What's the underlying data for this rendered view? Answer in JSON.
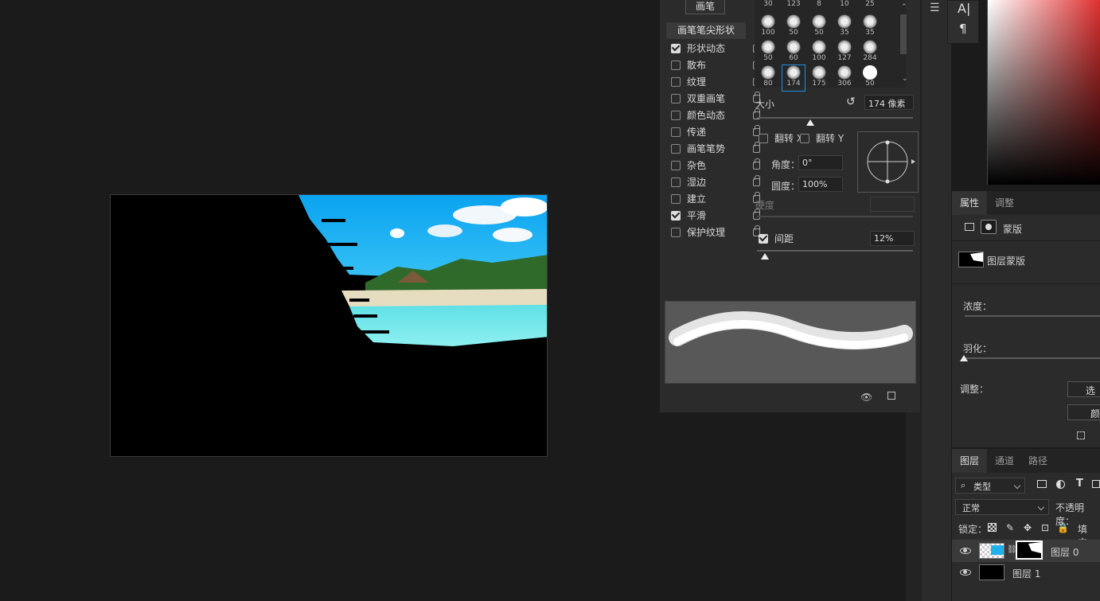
{
  "brush_panel": {
    "brush_button": "画笔",
    "tip_shape_header": "画笔笔尖形状",
    "options": [
      {
        "label": "形状动态",
        "checked": true
      },
      {
        "label": "散布",
        "checked": false
      },
      {
        "label": "纹理",
        "checked": false
      },
      {
        "label": "双重画笔",
        "checked": false
      },
      {
        "label": "颜色动态",
        "checked": false
      },
      {
        "label": "传递",
        "checked": false
      },
      {
        "label": "画笔笔势",
        "checked": false
      },
      {
        "label": "杂色",
        "checked": false
      },
      {
        "label": "湿边",
        "checked": false
      },
      {
        "label": "建立",
        "checked": false
      },
      {
        "label": "平滑",
        "checked": true
      },
      {
        "label": "保护纹理",
        "checked": false
      }
    ],
    "presets": [
      [
        "30",
        "123",
        "8",
        "10",
        "25"
      ],
      [
        "100",
        "50",
        "50",
        "35",
        "35"
      ],
      [
        "50",
        "60",
        "100",
        "127",
        "284"
      ],
      [
        "80",
        "174",
        "175",
        "306",
        "50"
      ]
    ],
    "size_label": "大小",
    "size_value": "174 像素",
    "size_fraction": 0.34,
    "flip_x_label": "翻转 X",
    "flip_y_label": "翻转 Y",
    "angle_label": "角度：",
    "angle_value": "0°",
    "roundness_label": "圆度：",
    "roundness_value": "100%",
    "hardness_label": "硬度",
    "spacing_label": "间距",
    "spacing_checked": true,
    "spacing_value": "12%",
    "spacing_fraction": 0.05
  },
  "properties": {
    "tabs": [
      "属性",
      "调整"
    ],
    "mask_label": "蒙版",
    "layer_mask_label": "图层蒙版",
    "density_label": "浓度：",
    "feather_label": "羽化：",
    "adjust_label": "调整：",
    "select_button": "选",
    "color_button": "颜"
  },
  "layers": {
    "tabs": [
      "图层",
      "通道",
      "路径"
    ],
    "filter_kind": "类型",
    "blend_mode": "正常",
    "opacity_label": "不透明度：",
    "lock_label": "锁定：",
    "fill_label": "填充：",
    "items": [
      {
        "name": "图层 0"
      },
      {
        "name": "图层 1"
      }
    ]
  },
  "colors": {
    "accent": "#1e8fe0",
    "panel_bg": "#2b2b2b",
    "workspace_bg": "#1b1b1b"
  }
}
